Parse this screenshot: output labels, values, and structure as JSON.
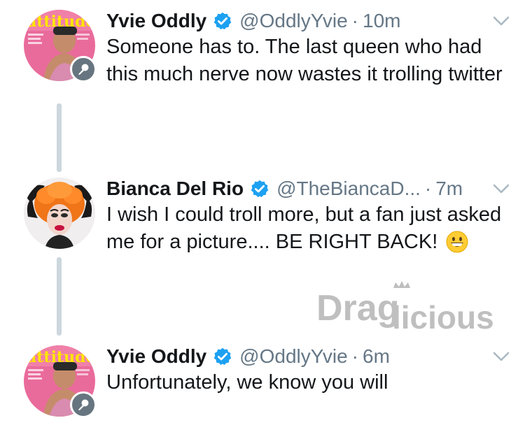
{
  "tweets": [
    {
      "name": "Yvie Oddly",
      "handle": "@OddlyYvie",
      "time": "10m",
      "text": "Someone has to. The last queen who had this much nerve now wastes it trolling twitter",
      "avatar": "Yvie Oddly magazine cover avatar",
      "avatar_text": "attitude"
    },
    {
      "name": "Bianca Del Rio",
      "handle": "@TheBiancaD...",
      "time": "7m",
      "text": "I wish I could troll more, but  a fan just asked me for a picture.... BE RIGHT BACK!",
      "emoji": "grinning-face",
      "avatar": "Bianca Del Rio drag queen avatar with orange hair"
    },
    {
      "name": "Yvie Oddly",
      "handle": "@OddlyYvie",
      "time": "6m",
      "text": "Unfortunately, we know you will",
      "avatar": "Yvie Oddly magazine cover avatar",
      "avatar_text": "attitude"
    }
  ],
  "separator": "·",
  "watermark": {
    "part1": "Drag",
    "part2": "licious"
  },
  "colors": {
    "text": "#14171a",
    "secondary": "#657786",
    "verified": "#1da1f2",
    "thread_line": "#ccd6dd",
    "mic_badge": "#66757f",
    "watermark": "#bfbfbf"
  },
  "icons": [
    "verified-badge-icon",
    "chevron-down-icon",
    "microphone-icon",
    "grinning-face-emoji-icon"
  ]
}
